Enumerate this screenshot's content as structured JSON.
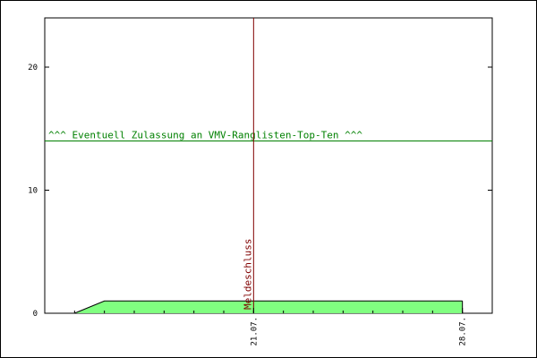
{
  "chart_data": {
    "type": "area",
    "title": "",
    "xlabel": "",
    "ylabel": "",
    "x_ticks": [
      "21.07.",
      "28.07."
    ],
    "y_ticks": [
      0,
      10,
      20
    ],
    "ylim": [
      0,
      24
    ],
    "x_dates": [
      "14.07.",
      "29.07."
    ],
    "series": [
      {
        "values": [
          {
            "x": "15.07.",
            "y": 0
          },
          {
            "x": "16.07.",
            "y": 1
          },
          {
            "x": "28.07.",
            "y": 1
          }
        ],
        "fill": "#80ff80",
        "line": "#000000"
      }
    ],
    "annotations": [
      {
        "kind": "hline",
        "y": 14,
        "label": "^^^ Eventuell Zulassung an VMV-Ranglisten-Top-Ten ^^^",
        "color": "#008000"
      },
      {
        "kind": "vline",
        "x": "21.07.",
        "label": "Meldeschluss",
        "color": "#800000"
      }
    ],
    "grid": false
  }
}
